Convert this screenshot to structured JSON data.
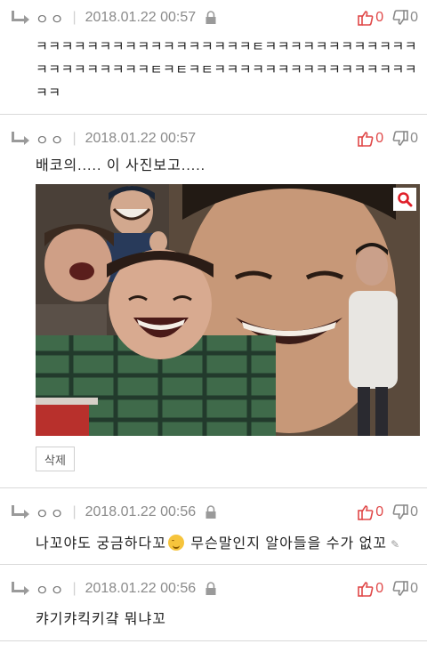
{
  "comments": [
    {
      "nick": "ㅇㅇ",
      "separator": "|",
      "date": "2018.01.22 00:57",
      "up": "0",
      "down": "0",
      "lines": [
        "ㅋㅋㅋㅋㅋㅋㅋㅋㅋㅋㅋㅋㅋㅋㅋㅋㅋㅌㅋㅋㅋㅋㅋㅋㅋㅋㅋㅋㅋㅋ",
        "ㅋㅋㅋㅋㅋㅋㅋㅋㅋㅌㅋㅌㅋㅌㅋㅋㅋㅋㅋㅋㅋㅋㅋㅋㅋㅋㅋㅋㅋㅋ",
        "ㅋㅋ"
      ]
    },
    {
      "nick": "ㅇㅇ",
      "separator": "|",
      "date": "2018.01.22 00:57",
      "up": "0",
      "down": "0",
      "text": "배코의..... 이 사진보고.....",
      "delete_label": "삭제"
    },
    {
      "nick": "ㅇㅇ",
      "separator": "|",
      "date": "2018.01.22 00:56",
      "up": "0",
      "down": "0",
      "text_before": "나꼬야도 궁금하다꼬",
      "text_after": " 무슨말인지 알아들을 수가 없꼬"
    },
    {
      "nick": "ㅇㅇ",
      "separator": "|",
      "date": "2018.01.22 00:56",
      "up": "0",
      "down": "0",
      "text": "캬기캬킥키걐 뭐냐꼬"
    }
  ],
  "icons": {
    "reply": "reply-arrow-icon",
    "lock": "lock-icon",
    "up": "thumbs-up-icon",
    "down": "thumbs-down-icon",
    "zoom": "magnifier-icon",
    "emoji": "smiling-face-emoji",
    "edited": "pencil-icon"
  },
  "colors": {
    "up": "#e04848",
    "down": "#8a8a8a",
    "zoom": "#e0202a"
  }
}
